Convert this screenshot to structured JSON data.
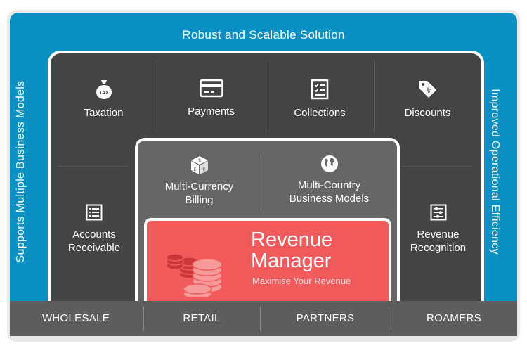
{
  "top_banner": "Robust and Scalable Solution",
  "left_banner": "Supports Multiple Business Models",
  "right_banner": "Improved Operational Efficiency",
  "modules": {
    "taxation": "Taxation",
    "payments": "Payments",
    "collections": "Collections",
    "discounts": "Discounts",
    "accounts_receivable": [
      "Accounts",
      "Receivable"
    ],
    "revenue_recognition": [
      "Revenue",
      "Recognition"
    ],
    "multi_currency": [
      "Multi-Currency",
      "Billing"
    ],
    "multi_country": [
      "Multi-Country",
      "Business Models"
    ]
  },
  "icons": {
    "tax": "tax-bag-icon",
    "payments": "credit-card-icon",
    "collections": "checklist-icon",
    "discounts": "price-tag-icon",
    "accounts": "list-icon",
    "recognition": "sliders-icon",
    "currency": "currency-cube-icon",
    "country": "globe-icon",
    "coins": "coin-stacks-icon",
    "tax_label": "TAX",
    "discount_label": "%"
  },
  "core": {
    "title_line1": "Revenue",
    "title_line2": "Manager",
    "tagline": "Maximise Your Revenue"
  },
  "segments": [
    "WHOLESALE",
    "RETAIL",
    "PARTNERS",
    "ROAMERS"
  ],
  "colors": {
    "banner_blue": "#0a90c2",
    "outer_dark": "#444444",
    "inner_gray": "#666666",
    "core_red": "#f25b5b",
    "bottom_bar": "#5d5d5d"
  }
}
